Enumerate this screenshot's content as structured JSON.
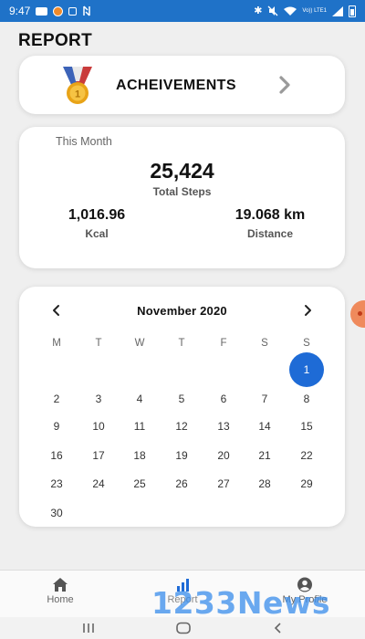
{
  "status_bar": {
    "time": "9:47",
    "lte": "Vo)) LTE1"
  },
  "page_title": "REPORT",
  "achievements": {
    "label": "ACHEIVEMENTS"
  },
  "stats": {
    "period_label": "This Month",
    "total_steps_value": "25,424",
    "total_steps_label": "Total Steps",
    "kcal_value": "1,016.96",
    "kcal_label": "Kcal",
    "distance_value": "19.068 km",
    "distance_label": "Distance"
  },
  "calendar": {
    "month_label": "November 2020",
    "weekdays": [
      "M",
      "T",
      "W",
      "T",
      "F",
      "S",
      "S"
    ],
    "first_weekday_index": 6,
    "days": [
      "1",
      "2",
      "3",
      "4",
      "5",
      "6",
      "7",
      "8",
      "9",
      "10",
      "11",
      "12",
      "13",
      "14",
      "15",
      "16",
      "17",
      "18",
      "19",
      "20",
      "21",
      "22",
      "23",
      "24",
      "25",
      "26",
      "27",
      "28",
      "29",
      "30"
    ],
    "selected_day": "1",
    "selected_color": "#1e6bd6"
  },
  "bottom_nav": {
    "items": [
      {
        "label": "Home",
        "icon": "home-icon"
      },
      {
        "label": "Report",
        "icon": "bar-chart-icon"
      },
      {
        "label": "My Profile",
        "icon": "profile-icon"
      }
    ]
  },
  "watermark": "1233News",
  "colors": {
    "status_bar": "#1f72c8",
    "accent": "#1e6bd6",
    "background": "#efefef"
  }
}
